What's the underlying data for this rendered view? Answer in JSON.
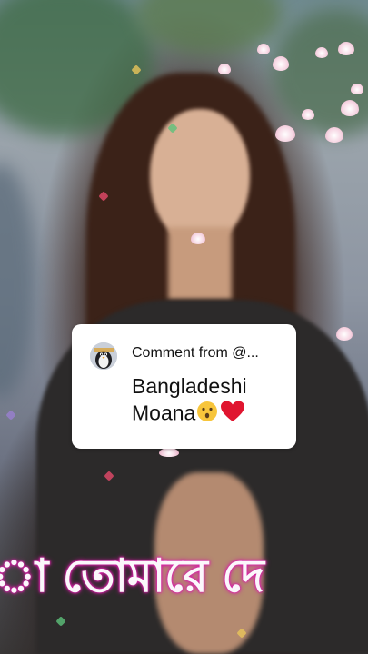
{
  "comment": {
    "from_label": "Comment from @...",
    "text": "Bangladeshi Moana",
    "emojis": [
      "hushed-face-emoji",
      "red-heart-emoji"
    ]
  },
  "caption": {
    "text": "া তোমারে দে"
  },
  "colors": {
    "caption_glow": "#d21ea3",
    "heart_red": "#e0152f",
    "comment_bg": "#ffffff"
  }
}
